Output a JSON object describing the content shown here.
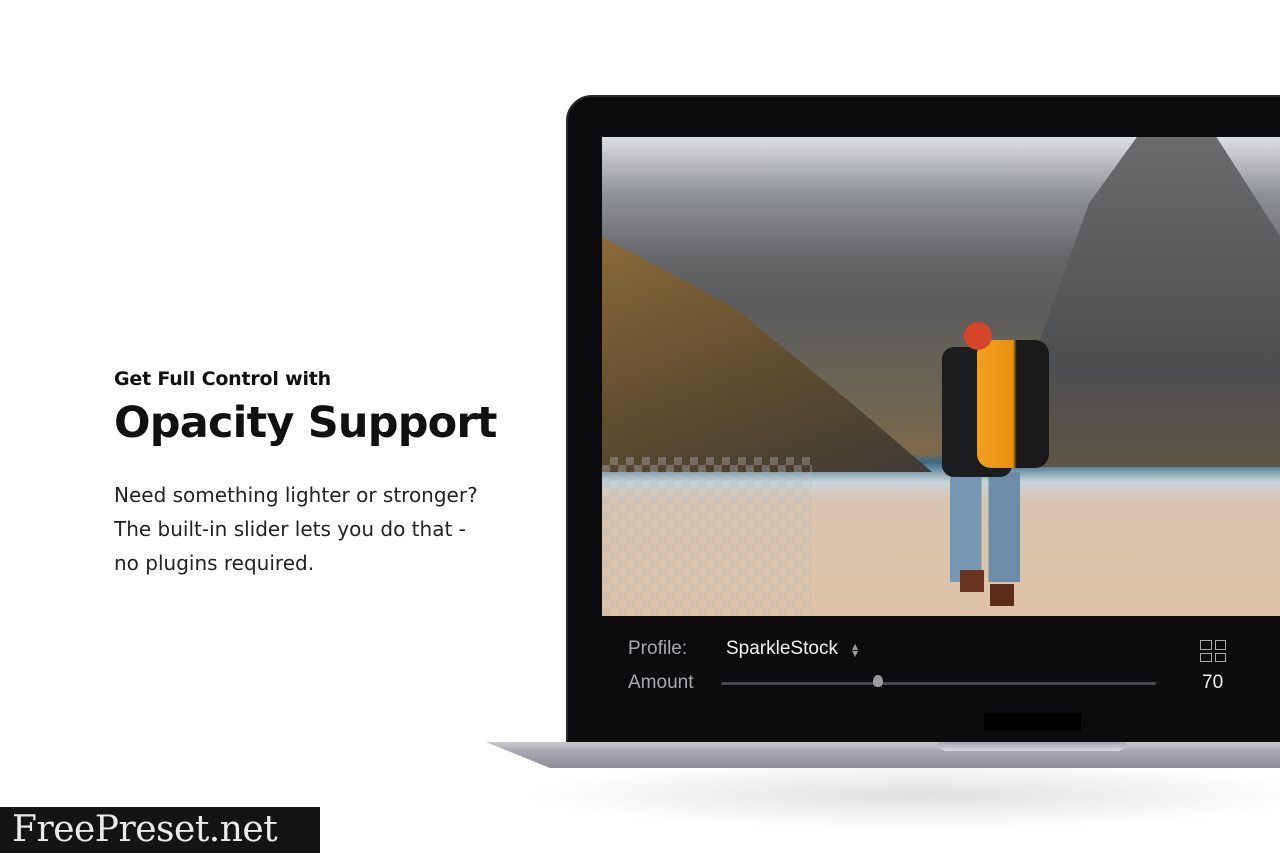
{
  "marketing": {
    "eyebrow": "Get Full Control with",
    "headline": "Opacity Support",
    "body_lines": [
      "Need something lighter or stronger?",
      "The built-in slider lets you do that -",
      "no plugins required."
    ]
  },
  "panel": {
    "profile_label": "Profile:",
    "profile_value": "SparkleStock",
    "amount_label": "Amount",
    "amount_value": "70",
    "grid_icon": "grid-view-icon"
  },
  "watermark": "FreePreset.net",
  "colors": {
    "screen_bg": "#0c0c0e",
    "accent_backpack": "#f0a020"
  }
}
